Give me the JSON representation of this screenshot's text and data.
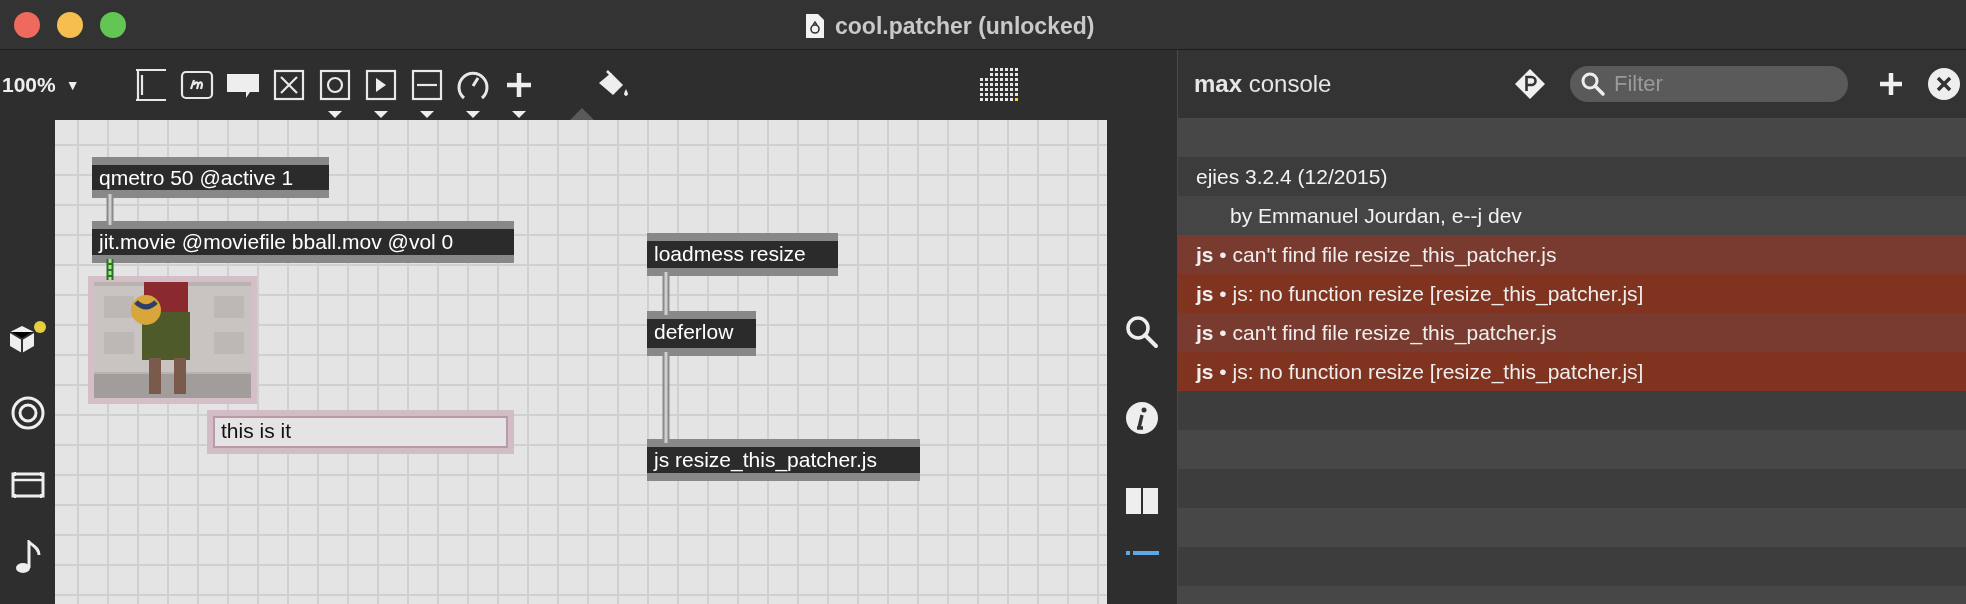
{
  "window": {
    "title": "cool.patcher (unlocked)"
  },
  "toolbar": {
    "zoom": "100%",
    "zoom_caret": "▼"
  },
  "patcher": {
    "objects": [
      {
        "kind": "object",
        "text": "qmetro 50 @active 1"
      },
      {
        "kind": "object",
        "text": "jit.movie @moviefile bball.mov @vol 0"
      },
      {
        "kind": "video"
      },
      {
        "kind": "comment",
        "text": "this is it"
      },
      {
        "kind": "object",
        "text": "loadmess resize"
      },
      {
        "kind": "object",
        "text": "deferlow"
      },
      {
        "kind": "object",
        "text": "js resize_this_patcher.js"
      }
    ],
    "cords": [
      {
        "kind": "message"
      },
      {
        "kind": "matrix"
      },
      {
        "kind": "message"
      },
      {
        "kind": "message"
      }
    ]
  },
  "console": {
    "title": "**max** console",
    "filter": {
      "placeholder": "Filter"
    },
    "messages": [
      {
        "kind": "info",
        "text": "ejies  3.2.4  (12/2015)"
      },
      {
        "kind": "continuation",
        "text": "by Emmanuel Jourdan, e--j dev"
      },
      {
        "kind": "error",
        "text": "**js** • can't find file resize_this_patcher.js"
      },
      {
        "kind": "error",
        "text": "**js** • js: no function resize [resize_this_patcher.js]"
      },
      {
        "kind": "error",
        "text": "**js** • can't find file resize_this_patcher.js"
      },
      {
        "kind": "error",
        "text": "**js** • js: no function resize [resize_this_patcher.js]"
      }
    ]
  }
}
